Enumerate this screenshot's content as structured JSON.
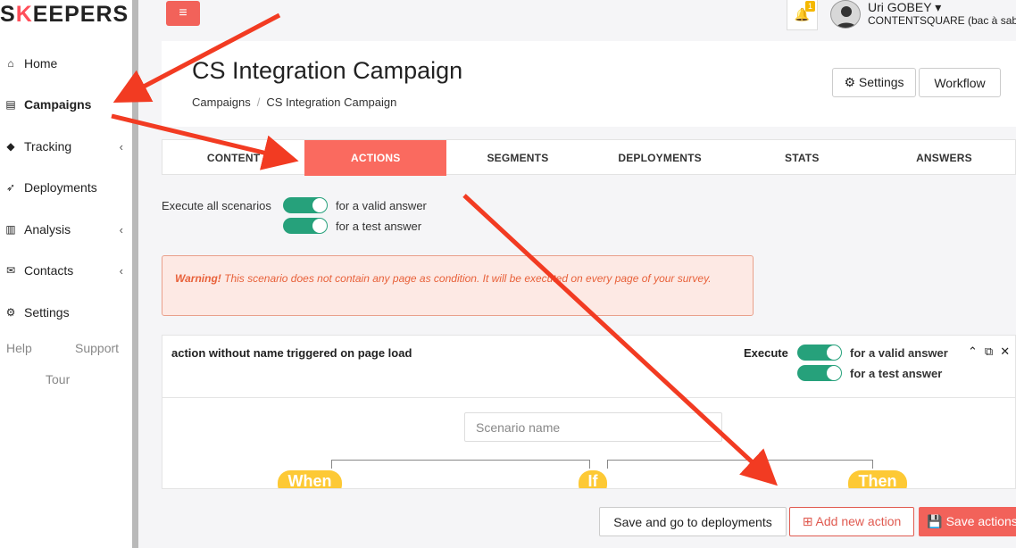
{
  "app": {
    "logo_prefix": "S",
    "logo_k": "K",
    "logo_rest": "EEPERS"
  },
  "sidebar": {
    "items": [
      {
        "label": "Home",
        "icon": "home-icon",
        "glyph": "⌂",
        "has_chevron": false,
        "active": false
      },
      {
        "label": "Campaigns",
        "icon": "document-icon",
        "glyph": "▤",
        "has_chevron": false,
        "active": true
      },
      {
        "label": "Tracking",
        "icon": "tag-icon",
        "glyph": "◆",
        "has_chevron": true,
        "active": false
      },
      {
        "label": "Deployments",
        "icon": "rocket-icon",
        "glyph": "➶",
        "has_chevron": false,
        "active": false
      },
      {
        "label": "Analysis",
        "icon": "bar-chart-icon",
        "glyph": "▥",
        "has_chevron": true,
        "active": false
      },
      {
        "label": "Contacts",
        "icon": "envelope-icon",
        "glyph": "✉",
        "has_chevron": true,
        "active": false
      },
      {
        "label": "Settings",
        "icon": "gear-icon",
        "glyph": "⚙",
        "has_chevron": false,
        "active": false
      }
    ],
    "chevron": "‹",
    "help": "Help",
    "support": "Support",
    "tour": "Tour"
  },
  "topbar": {
    "menu_glyph": "≡",
    "bell_glyph": "🔔",
    "notification_count": "1",
    "user_name": "Uri GOBEY ▾",
    "user_org": "CONTENTSQUARE (bac à sable)"
  },
  "header": {
    "title": "CS Integration Campaign",
    "breadcrumb": [
      "Campaigns",
      "CS Integration Campaign"
    ],
    "breadcrumb_sep": "/",
    "settings_label": "⚙ Settings",
    "workflow_label": "Workflow"
  },
  "tabs": [
    {
      "label": "CONTENT",
      "active": false
    },
    {
      "label": "ACTIONS",
      "active": true
    },
    {
      "label": "SEGMENTS",
      "active": false
    },
    {
      "label": "DEPLOYMENTS",
      "active": false
    },
    {
      "label": "STATS",
      "active": false
    },
    {
      "label": "ANSWERS",
      "active": false
    }
  ],
  "execute": {
    "label": "Execute all scenarios",
    "valid": "for a valid answer",
    "test": "for a test answer"
  },
  "warning": {
    "strong": "Warning!",
    "text": " This scenario does not contain any page as condition. It will be executed on every page of your survey."
  },
  "scenario": {
    "title": "action without name triggered on page load",
    "execute_label": "Execute",
    "valid": "for a valid answer",
    "test": "for a test answer",
    "name_placeholder": "Scenario name",
    "icons": {
      "collapse": "⌃",
      "copy": "⧉",
      "close": "✕"
    },
    "tags": {
      "when": "When",
      "if": "If",
      "then": "Then"
    }
  },
  "bottom": {
    "save_deploy": "Save and go to deployments",
    "add_action": "⊞ Add new action",
    "save_actions": "💾 Save actions"
  },
  "colors": {
    "accent": "#f2625a",
    "toggle": "#26a17b",
    "tag": "#fdc935",
    "arrow": "#f23b22"
  }
}
